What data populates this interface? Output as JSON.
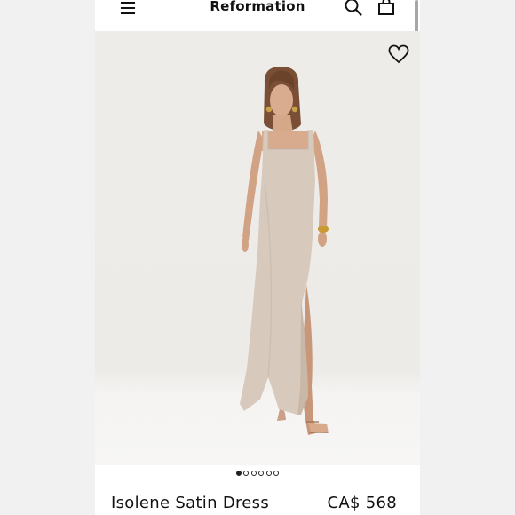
{
  "header": {
    "brand": "Reformation",
    "menu_icon": "hamburger-menu-icon",
    "search_icon": "search-icon",
    "bag_icon": "shopping-bag-icon"
  },
  "product": {
    "name": "Isolene Satin Dress",
    "price": "CA$ 568",
    "image_alt": "Model wearing Isolene Satin Dress",
    "dress_color": "#d7cabd",
    "wishlist_icon": "heart-icon"
  },
  "gallery": {
    "image_count": 6,
    "active_index": 0
  }
}
